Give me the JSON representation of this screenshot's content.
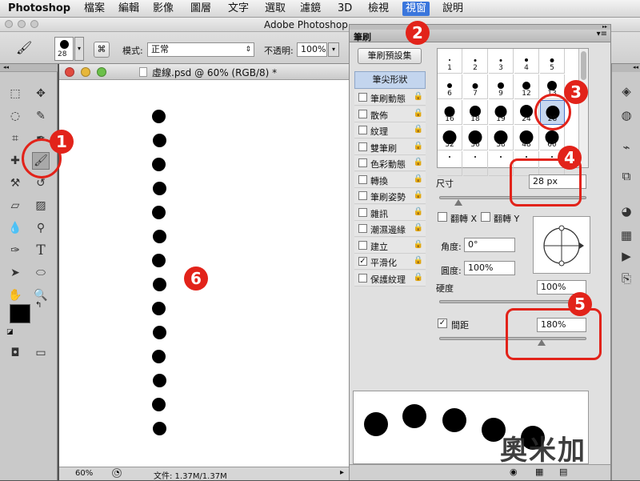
{
  "menubar": {
    "app": "Photoshop",
    "items": [
      "檔案",
      "編輯",
      "影像",
      "圖層",
      "文字",
      "選取",
      "濾鏡",
      "3D",
      "檢視",
      "視窗",
      "說明"
    ],
    "active_item": "視窗"
  },
  "app_title": "Adobe Photoshop",
  "options_bar": {
    "brush_size": "28",
    "mode_label": "模式:",
    "mode_value": "正常",
    "opacity_label": "不透明:",
    "opacity_value": "100%"
  },
  "document": {
    "title": "虛線.psd @ 60% (RGB/8) *",
    "zoom": "60%",
    "file_info": "文件: 1.37M/1.37M",
    "dot_count": 14
  },
  "brush_panel": {
    "tab": "筆刷",
    "preset_button": "筆刷預設集",
    "tip_shape_label": "筆尖形狀",
    "options": [
      {
        "label": "筆刷動態",
        "checked": false
      },
      {
        "label": "散佈",
        "checked": false
      },
      {
        "label": "紋理",
        "checked": false
      },
      {
        "label": "雙筆刷",
        "checked": false
      },
      {
        "label": "色彩動態",
        "checked": false
      },
      {
        "label": "轉換",
        "checked": false
      },
      {
        "label": "筆刷姿勢",
        "checked": false
      },
      {
        "label": "雜訊",
        "checked": false
      },
      {
        "label": "潮濕邊緣",
        "checked": false
      },
      {
        "label": "建立",
        "checked": false
      },
      {
        "label": "平滑化",
        "checked": true
      },
      {
        "label": "保護紋理",
        "checked": false
      }
    ],
    "presets": [
      {
        "size": "1"
      },
      {
        "size": "3"
      },
      {
        "size": "5"
      },
      {
        "size": "9"
      },
      {
        "size": "13"
      },
      {
        "size": "19"
      },
      {
        "size": "5"
      },
      {
        "size": "9"
      },
      {
        "size": "13"
      },
      {
        "size": "17"
      },
      {
        "size": "21"
      },
      {
        "size": "27"
      },
      {
        "size": "35"
      },
      {
        "size": "45"
      },
      {
        "size": "65"
      },
      {
        "size": "100"
      },
      {
        "size": "200"
      },
      {
        "size": "300"
      },
      {
        "size": "9"
      },
      {
        "size": "13"
      },
      {
        "size": "19"
      },
      {
        "size": "17"
      },
      {
        "size": "45"
      },
      {
        "size": "65"
      },
      {
        "size": "100"
      },
      {
        "size": "200"
      },
      {
        "size": "300"
      },
      {
        "size": "14"
      },
      {
        "size": "24"
      },
      {
        "size": "27"
      }
    ],
    "preset_labels": [
      "1",
      "2",
      "3",
      "4",
      "5",
      "6",
      "7",
      "9",
      "12",
      "13",
      "16",
      "18",
      "19",
      "24",
      "28",
      "32",
      "36",
      "38",
      "48",
      "60"
    ],
    "selected_preset": "28",
    "size_label": "尺寸",
    "size_value": "28 px",
    "flip_x": "翻轉 X",
    "flip_y": "翻轉 Y",
    "angle_label": "角度:",
    "angle_value": "0°",
    "roundness_label": "圓度:",
    "roundness_value": "100%",
    "hardness_label": "硬度",
    "hardness_value": "100%",
    "spacing_label": "間距",
    "spacing_value": "180%",
    "spacing_checked": true
  },
  "callouts": [
    "1",
    "2",
    "3",
    "4",
    "5",
    "6"
  ],
  "watermark": "奧米加",
  "accent": "#e2231a",
  "menu_highlight": "#3a76dc",
  "icons": {
    "brush": "brush-icon",
    "lock": "lock-icon",
    "gear": "gear-icon"
  }
}
